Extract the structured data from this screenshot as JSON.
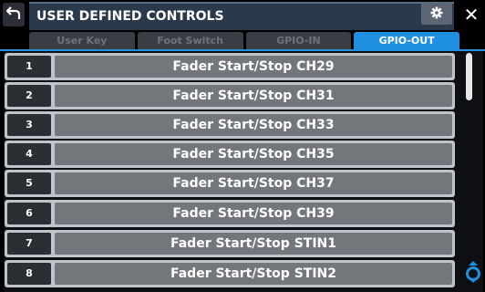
{
  "header": {
    "title": "USER DEFINED CONTROLS",
    "back_icon": "back-arrow-icon",
    "settings_icon": "gear-icon",
    "close_label": "✕"
  },
  "tabs": [
    {
      "label": "User Key",
      "active": false
    },
    {
      "label": "Foot Switch",
      "active": false
    },
    {
      "label": "GPIO-IN",
      "active": false
    },
    {
      "label": "GPIO-OUT",
      "active": true
    }
  ],
  "rows": [
    {
      "num": "1",
      "label": "Fader Start/Stop CH29"
    },
    {
      "num": "2",
      "label": "Fader Start/Stop CH31"
    },
    {
      "num": "3",
      "label": "Fader Start/Stop CH33"
    },
    {
      "num": "4",
      "label": "Fader Start/Stop CH35"
    },
    {
      "num": "5",
      "label": "Fader Start/Stop CH37"
    },
    {
      "num": "6",
      "label": "Fader Start/Stop CH39"
    },
    {
      "num": "7",
      "label": "Fader Start/Stop STIN1"
    },
    {
      "num": "8",
      "label": "Fader Start/Stop STIN2"
    }
  ],
  "colors": {
    "accent": "#1f8fe0",
    "title_bg": "#2a3a4c"
  }
}
